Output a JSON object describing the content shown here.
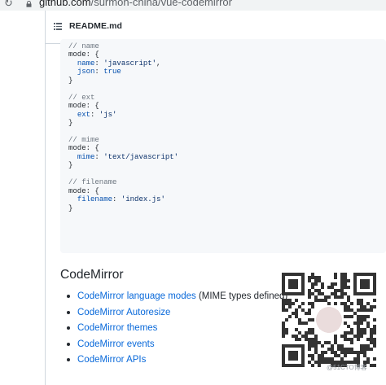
{
  "browser": {
    "url_host": "github.com",
    "url_path": "/surmon-china/vue-codemirror",
    "reload_icon": "reload-icon",
    "lock_icon": "lock-icon"
  },
  "readme": {
    "toc_icon": "list-unordered-icon",
    "title": "README.md"
  },
  "code_block": {
    "lines": [
      "// name",
      "mode: {",
      "  name: 'javascript',",
      "  json: true",
      "}",
      "",
      "// ext",
      "mode: {",
      "  ext: 'js'",
      "}",
      "",
      "// mime",
      "mode: {",
      "  mime: 'text/javascript'",
      "}",
      "",
      "// filename",
      "mode: {",
      "  filename: 'index.js'",
      "}"
    ]
  },
  "section": {
    "heading": "CodeMirror",
    "links": [
      {
        "label": "CodeMirror language modes",
        "suffix": " (MIME types defined)"
      },
      {
        "label": "CodeMirror Autoresize",
        "suffix": ""
      },
      {
        "label": "CodeMirror themes",
        "suffix": ""
      },
      {
        "label": "CodeMirror events",
        "suffix": ""
      },
      {
        "label": "CodeMirror APIs",
        "suffix": ""
      }
    ]
  },
  "watermark": "@51CTO博客",
  "colors": {
    "link": "#0969da",
    "text": "#24292f",
    "code_bg": "#f6f8fa",
    "border": "#d0d7de"
  }
}
